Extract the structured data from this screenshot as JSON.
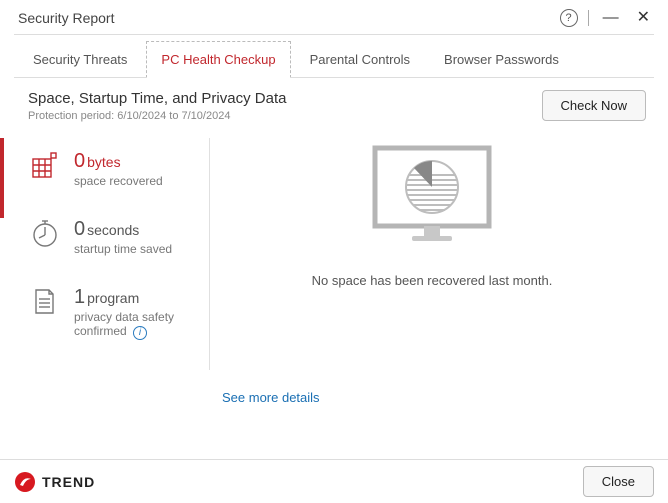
{
  "window": {
    "title": "Security Report"
  },
  "tabs": {
    "t0": "Security Threats",
    "t1": "PC Health Checkup",
    "t2": "Parental Controls",
    "t3": "Browser Passwords"
  },
  "section": {
    "title": "Space, Startup Time, and Privacy Data",
    "period": "Protection period: 6/10/2024 to 7/10/2024",
    "check_now": "Check Now"
  },
  "stats": {
    "space": {
      "value": "0",
      "unit": "bytes",
      "label": "space recovered"
    },
    "startup": {
      "value": "0",
      "unit": "seconds",
      "label": "startup time saved"
    },
    "privacy": {
      "value": "1",
      "unit": "program",
      "label": "privacy data safety confirmed"
    }
  },
  "status": {
    "message": "No space has been recovered last month."
  },
  "links": {
    "see_more": "See more details"
  },
  "footer": {
    "brand": "TREND",
    "close": "Close"
  }
}
